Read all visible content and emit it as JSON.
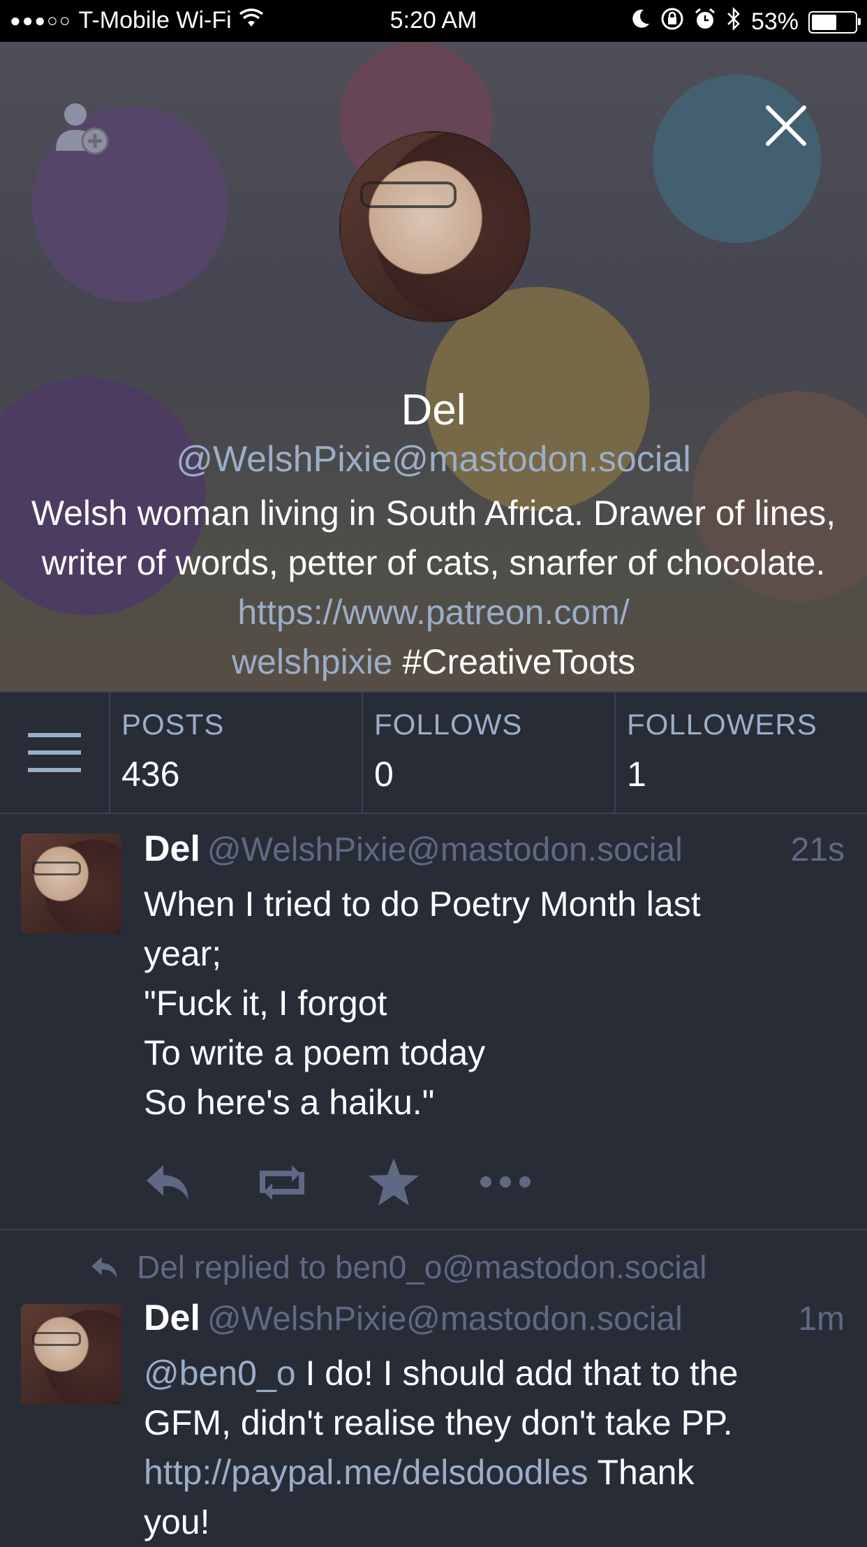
{
  "statusbar": {
    "carrier": "T-Mobile Wi-Fi",
    "time": "5:20 AM",
    "battery": "53%"
  },
  "profile": {
    "display_name": "Del",
    "handle": "@WelshPixie@mastodon.social",
    "bio_text": "Welsh woman living in South Africa. Drawer of lines, writer of words, petter of cats, snarfer of chocolate. ",
    "bio_link": "https://www.patreon.com/welshpixie",
    "bio_link_part1": "https://www.patreon.com/",
    "bio_link_part2": "welshpixie",
    "bio_hashtag": "#CreativeToots"
  },
  "stats": {
    "posts_label": "POSTS",
    "posts_value": "436",
    "follows_label": "FOLLOWS",
    "follows_value": "0",
    "followers_label": "FOLLOWERS",
    "followers_value": "1"
  },
  "statuses": [
    {
      "display_name": "Del",
      "acct": "@WelshPixie@mastodon.social",
      "time": "21s",
      "lines": [
        "When I tried to do Poetry Month last",
        "year;",
        "\"Fuck it, I forgot",
        "To write a poem today",
        "So here's a haiku.\""
      ]
    },
    {
      "reply_note": "Del replied to ben0_o@mastodon.social",
      "display_name": "Del",
      "acct": "@WelshPixie@mastodon.social",
      "time": "1m",
      "mention": "@ben0_o",
      "text1": " I do! I should add that to the",
      "text2": "GFM, didn't realise they don't take PP.",
      "link": "http://paypal.me/delsdoodles",
      "text3": " Thank",
      "text4": "you!"
    }
  ],
  "colors": {
    "background": "#282c37",
    "muted": "#606984",
    "link": "#9baec8",
    "divider": "#3d4251"
  },
  "icons": [
    "wifi-icon",
    "moon-icon",
    "rotation-lock-icon",
    "alarm-icon",
    "bluetooth-icon",
    "battery-icon",
    "follow-user-icon",
    "close-icon",
    "menu-icon",
    "reply-icon",
    "boost-icon",
    "favourite-icon",
    "more-icon"
  ]
}
